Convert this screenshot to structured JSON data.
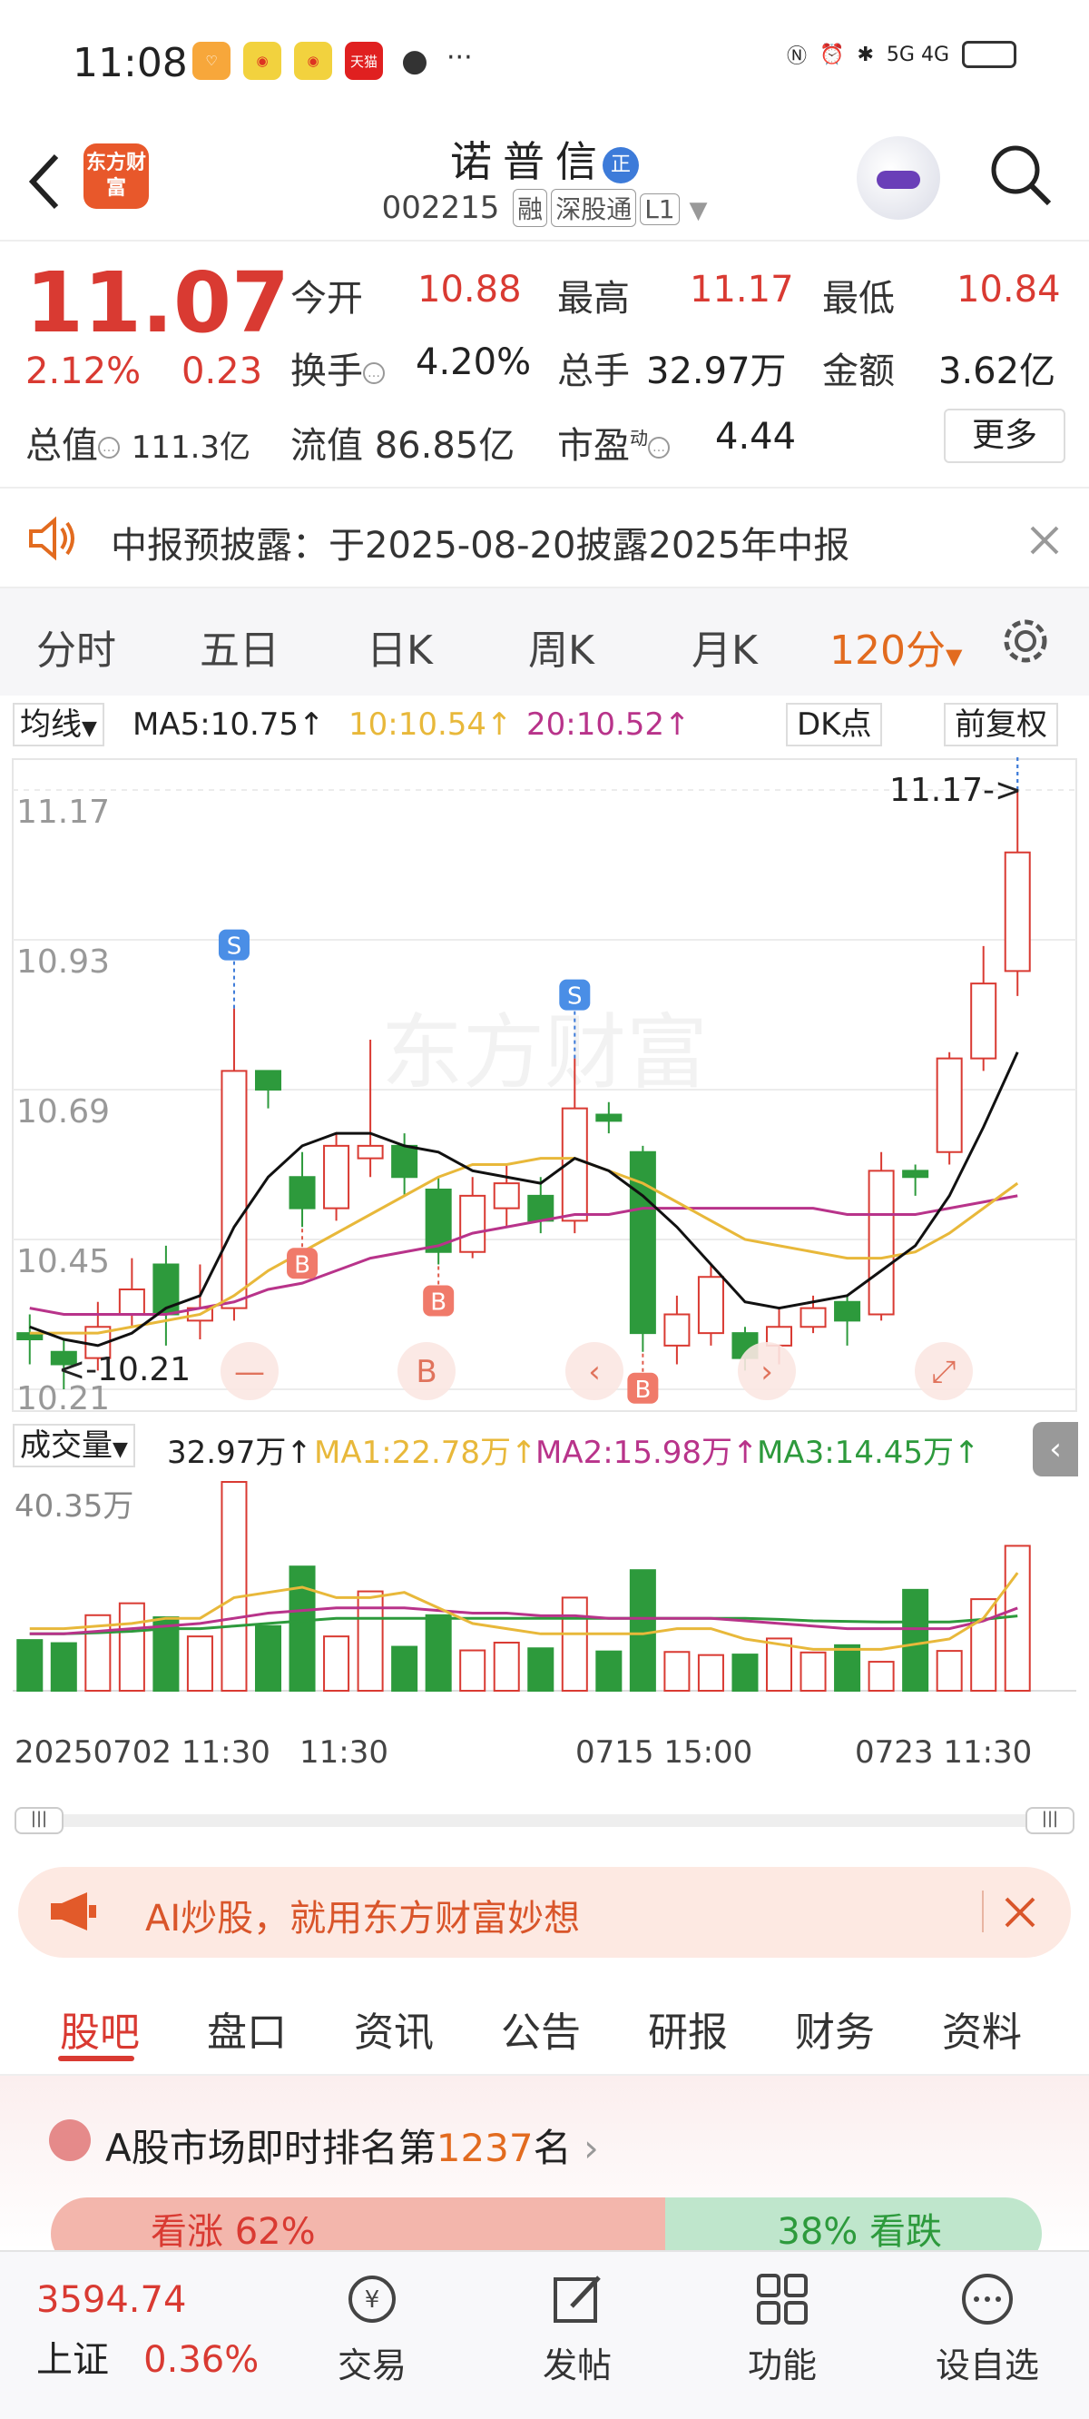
{
  "status": {
    "time": "11:08",
    "app_icon_label": "天猫",
    "network": "5G 4G"
  },
  "header": {
    "logo": "东方财富",
    "stock_name": "诺普信",
    "badge": "正",
    "code": "002215",
    "tags": [
      "融",
      "深股通",
      "L1"
    ]
  },
  "quote": {
    "price": "11.07",
    "change_pct": "2.12%",
    "change": "0.23",
    "open_label": "今开",
    "open": "10.88",
    "high_label": "最高",
    "high": "11.17",
    "low_label": "最低",
    "low": "10.84",
    "turnover_label": "换手",
    "turnover": "4.20%",
    "volume_label": "总手",
    "volume": "32.97万",
    "amount_label": "金额",
    "amount": "3.62亿",
    "mktcap_label": "总值",
    "mktcap": "111.3亿",
    "float_label": "流值",
    "float": "86.85亿",
    "pe_label": "市盈",
    "pe_sup": "动",
    "pe": "4.44",
    "more": "更多"
  },
  "notice": {
    "text": "中报预披露：于2025-08-20披露2025年中报"
  },
  "chart_tabs": [
    "分时",
    "五日",
    "日K",
    "周K",
    "月K",
    "120分"
  ],
  "indicators": {
    "type": "均线",
    "ma5": "MA5:10.75↑",
    "ma10": "10:10.54↑",
    "ma20": "20:10.52↑",
    "dk": "DK点",
    "adjust": "前复权"
  },
  "kline_labels": {
    "y_ticks": [
      "11.17",
      "10.93",
      "10.69",
      "10.45",
      "10.21"
    ],
    "high_marker": "11.17->",
    "low_marker": "<-10.21",
    "watermark": "东方财富"
  },
  "volume": {
    "label": "成交量",
    "value": "32.97万↑",
    "ma1": "MA1:22.78万↑",
    "ma2": "MA2:15.98万↑",
    "ma3": "MA3:14.45万↑",
    "max": "40.35万"
  },
  "time_axis": [
    "20250702 11:30",
    "11:30",
    "0715 15:00",
    "0723 11:30"
  ],
  "ad": {
    "text": "AI炒股，就用东方财富妙想"
  },
  "sub_tabs": [
    "股吧",
    "盘口",
    "资讯",
    "公告",
    "研报",
    "财务",
    "资料"
  ],
  "rank": {
    "prefix": "A股市场即时排名第",
    "number": "1237",
    "suffix": "名",
    "up": "看涨 62%",
    "down": "38% 看跌",
    "up_share": 62
  },
  "bottom": {
    "index_value": "3594.74",
    "index_name": "上证",
    "index_pct": "0.36%",
    "items": [
      "交易",
      "发帖",
      "功能",
      "设自选"
    ]
  },
  "colors": {
    "up": "#d93a32",
    "down": "#2d9a3c",
    "accent": "#e26b1f",
    "ma5": "#111111",
    "ma10": "#e8b83a",
    "ma20": "#b8338a"
  },
  "chart_data": {
    "type": "candlestick",
    "title": "",
    "ylim": [
      10.21,
      11.17
    ],
    "candles": [
      {
        "o": 10.3,
        "c": 10.29,
        "h": 10.33,
        "l": 10.25
      },
      {
        "o": 10.27,
        "c": 10.25,
        "h": 10.29,
        "l": 10.21
      },
      {
        "o": 10.26,
        "c": 10.31,
        "h": 10.35,
        "l": 10.24
      },
      {
        "o": 10.33,
        "c": 10.37,
        "h": 10.42,
        "l": 10.31
      },
      {
        "o": 10.41,
        "c": 10.33,
        "h": 10.44,
        "l": 10.28
      },
      {
        "o": 10.32,
        "c": 10.34,
        "h": 10.41,
        "l": 10.29
      },
      {
        "o": 10.34,
        "c": 10.72,
        "h": 10.82,
        "l": 10.32
      },
      {
        "o": 10.72,
        "c": 10.69,
        "h": 10.72,
        "l": 10.66
      },
      {
        "o": 10.55,
        "c": 10.5,
        "h": 10.59,
        "l": 10.47
      },
      {
        "o": 10.5,
        "c": 10.6,
        "h": 10.62,
        "l": 10.48
      },
      {
        "o": 10.58,
        "c": 10.6,
        "h": 10.77,
        "l": 10.55
      },
      {
        "o": 10.6,
        "c": 10.55,
        "h": 10.62,
        "l": 10.52
      },
      {
        "o": 10.53,
        "c": 10.43,
        "h": 10.55,
        "l": 10.41
      },
      {
        "o": 10.43,
        "c": 10.52,
        "h": 10.55,
        "l": 10.42
      },
      {
        "o": 10.5,
        "c": 10.54,
        "h": 10.57,
        "l": 10.47
      },
      {
        "o": 10.52,
        "c": 10.48,
        "h": 10.55,
        "l": 10.46
      },
      {
        "o": 10.48,
        "c": 10.66,
        "h": 10.74,
        "l": 10.46
      },
      {
        "o": 10.65,
        "c": 10.64,
        "h": 10.67,
        "l": 10.62
      },
      {
        "o": 10.59,
        "c": 10.3,
        "h": 10.6,
        "l": 10.27
      },
      {
        "o": 10.28,
        "c": 10.33,
        "h": 10.36,
        "l": 10.25
      },
      {
        "o": 10.3,
        "c": 10.39,
        "h": 10.41,
        "l": 10.28
      },
      {
        "o": 10.3,
        "c": 10.26,
        "h": 10.31,
        "l": 10.24
      },
      {
        "o": 10.28,
        "c": 10.31,
        "h": 10.34,
        "l": 10.25
      },
      {
        "o": 10.31,
        "c": 10.34,
        "h": 10.36,
        "l": 10.3
      },
      {
        "o": 10.35,
        "c": 10.32,
        "h": 10.36,
        "l": 10.28
      },
      {
        "o": 10.33,
        "c": 10.56,
        "h": 10.59,
        "l": 10.32
      },
      {
        "o": 10.56,
        "c": 10.55,
        "h": 10.57,
        "l": 10.52
      },
      {
        "o": 10.59,
        "c": 10.74,
        "h": 10.75,
        "l": 10.57
      },
      {
        "o": 10.74,
        "c": 10.86,
        "h": 10.92,
        "l": 10.72
      },
      {
        "o": 10.88,
        "c": 11.07,
        "h": 11.17,
        "l": 10.84
      }
    ],
    "ma5": [
      10.31,
      10.29,
      10.28,
      10.3,
      10.34,
      10.36,
      10.47,
      10.55,
      10.6,
      10.62,
      10.62,
      10.6,
      10.59,
      10.56,
      10.55,
      10.54,
      10.58,
      10.56,
      10.52,
      10.47,
      10.41,
      10.35,
      10.34,
      10.35,
      10.36,
      10.4,
      10.44,
      10.52,
      10.63,
      10.75
    ],
    "ma10": [
      10.3,
      10.3,
      10.3,
      10.31,
      10.32,
      10.33,
      10.36,
      10.4,
      10.43,
      10.46,
      10.49,
      10.52,
      10.55,
      10.57,
      10.57,
      10.58,
      10.58,
      10.56,
      10.54,
      10.51,
      10.48,
      10.45,
      10.44,
      10.43,
      10.42,
      10.42,
      10.43,
      10.46,
      10.5,
      10.54
    ],
    "ma20": [
      10.34,
      10.33,
      10.33,
      10.33,
      10.33,
      10.34,
      10.35,
      10.37,
      10.38,
      10.4,
      10.42,
      10.43,
      10.44,
      10.46,
      10.47,
      10.48,
      10.49,
      10.49,
      10.5,
      10.5,
      10.5,
      10.5,
      10.5,
      10.5,
      10.49,
      10.49,
      10.49,
      10.5,
      10.51,
      10.52
    ],
    "volume": [
      9.8,
      9.2,
      14.6,
      16.9,
      14.2,
      10.5,
      40.35,
      12.5,
      24,
      10.5,
      19.2,
      8.5,
      14.6,
      7.8,
      9.3,
      8.2,
      18,
      7.6,
      23.3,
      7.5,
      6.9,
      7.0,
      10.1,
      7.4,
      8.8,
      5.6,
      19.5,
      7.7,
      17.7,
      28.0
    ],
    "vol_ma1": [
      12,
      12,
      12.5,
      13,
      14,
      14,
      18,
      19,
      20,
      18,
      18,
      19,
      16,
      13,
      12,
      11,
      11,
      11,
      11,
      12,
      12,
      10,
      9,
      8,
      8,
      8,
      9,
      10,
      14,
      22.78
    ],
    "vol_ma2": [
      11,
      11,
      11.5,
      12,
      12.5,
      13,
      14,
      15,
      15.5,
      16,
      16,
      16,
      15.5,
      15,
      15,
      14.5,
      14.5,
      14,
      14,
      14,
      14,
      13.5,
      13,
      12.5,
      12,
      12,
      12,
      12,
      13.5,
      15.98
    ],
    "vol_ma3": [
      11,
      11,
      11.2,
      11.5,
      12,
      12,
      12.5,
      13,
      13.5,
      14,
      14,
      14,
      14,
      14,
      14,
      14,
      14,
      14,
      14,
      14,
      14,
      14,
      13.8,
      13.5,
      13.4,
      13.3,
      13.3,
      13.3,
      13.8,
      14.45
    ],
    "signals": [
      {
        "type": "S",
        "bar": 6
      },
      {
        "type": "B",
        "bar": 8
      },
      {
        "type": "B",
        "bar": 12
      },
      {
        "type": "S",
        "bar": 16
      },
      {
        "type": "B",
        "bar": 18
      },
      {
        "type": "S",
        "bar": 29
      },
      {
        "type": "S",
        "bar": 30
      }
    ]
  }
}
